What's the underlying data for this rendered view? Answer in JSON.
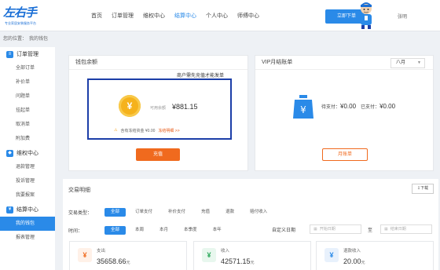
{
  "logo": {
    "mark": "左右手",
    "sub": "专业家居安装服务平台"
  },
  "nav": {
    "items": [
      {
        "label": "首页",
        "active": false
      },
      {
        "label": "订单管理",
        "active": false
      },
      {
        "label": "维权中心",
        "active": false
      },
      {
        "label": "结算中心",
        "active": true
      },
      {
        "label": "个人中心",
        "active": false
      },
      {
        "label": "师傅中心",
        "active": false
      }
    ],
    "order_button": "立即下单",
    "user_name": "张明"
  },
  "breadcrumb": {
    "prefix": "您的位置：",
    "current": "我的钱包"
  },
  "sidebar": {
    "groups": [
      {
        "label": "订单管理",
        "icon": "order-icon",
        "items": [
          {
            "label": "全部订单",
            "active": false
          },
          {
            "label": "补价单",
            "active": false
          },
          {
            "label": "问题单",
            "active": false
          },
          {
            "label": "挂起单",
            "active": false
          },
          {
            "label": "取消单",
            "active": false
          },
          {
            "label": "附加费",
            "active": false
          }
        ]
      },
      {
        "label": "维权中心",
        "icon": "shield-icon",
        "items": [
          {
            "label": "退款管理",
            "active": false
          },
          {
            "label": "投诉管理",
            "active": false
          },
          {
            "label": "我要报案",
            "active": false
          }
        ]
      },
      {
        "label": "结算中心",
        "icon": "settlement-icon",
        "items": [
          {
            "label": "我的钱包",
            "active": true
          },
          {
            "label": "报表管理",
            "active": false
          }
        ]
      }
    ]
  },
  "wallet": {
    "title": "钱包余额",
    "notice": "商户需先充值才能发单",
    "balance_label": "可用余额",
    "balance_value": "¥881.15",
    "frozen_text": "含有冻结资金 ¥0.00",
    "frozen_link": "冻结明细 >>",
    "recharge_button": "充值"
  },
  "vip": {
    "title": "VIP月结账单",
    "month": "八月",
    "unpaid_label": "待支付：",
    "unpaid_value": "¥0.00",
    "paid_label": "已支付：",
    "paid_value": "¥0.00",
    "bill_button": "月账单"
  },
  "transactions": {
    "title": "交易明细",
    "download": "下载",
    "type_label": "交易类型：",
    "types": [
      {
        "label": "全部",
        "active": true
      },
      {
        "label": "订单支付",
        "active": false
      },
      {
        "label": "补价支付",
        "active": false
      },
      {
        "label": "充值",
        "active": false
      },
      {
        "label": "退款",
        "active": false
      },
      {
        "label": "赔付收入",
        "active": false
      }
    ],
    "time_label": "时间：",
    "times": [
      {
        "label": "全部",
        "active": true
      },
      {
        "label": "本周",
        "active": false
      },
      {
        "label": "本月",
        "active": false
      },
      {
        "label": "本季度",
        "active": false
      },
      {
        "label": "本年",
        "active": false
      }
    ],
    "custom_date_label": "自定义日期",
    "start_placeholder": "开始日期",
    "to": "至",
    "end_placeholder": "结束日期",
    "stats": [
      {
        "label": "支出",
        "value": "35658.66",
        "unit": "元",
        "icon": "expense-icon",
        "color": "#f06a1e",
        "bg": "#fff1e8"
      },
      {
        "label": "收入",
        "value": "42571.15",
        "unit": "元",
        "icon": "income-icon",
        "color": "#2aa85a",
        "bg": "#e8f7ee"
      },
      {
        "label": "退款收入",
        "value": "20.00",
        "unit": "元",
        "icon": "refund-icon",
        "color": "#2a8ae8",
        "bg": "#e8f1fc"
      }
    ]
  }
}
